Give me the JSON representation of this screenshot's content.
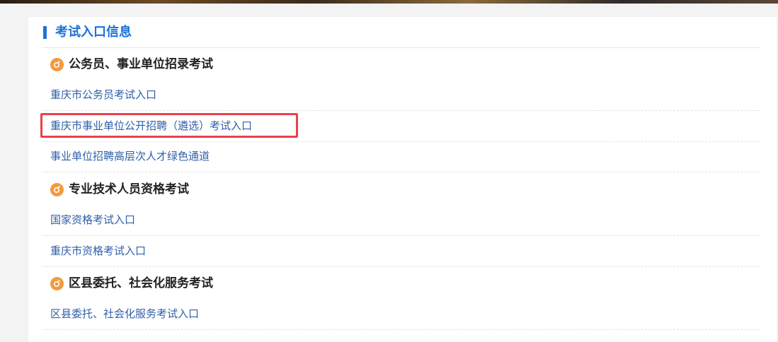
{
  "panel": {
    "title": "考试入口信息"
  },
  "sections": [
    {
      "title": "公务员、事业单位招录考试",
      "links": [
        "重庆市公务员考试入口",
        "重庆市事业单位公开招聘（遴选）考试入口",
        "事业单位招聘高层次人才绿色通道"
      ]
    },
    {
      "title": "专业技术人员资格考试",
      "links": [
        "国家资格考试入口",
        "重庆市资格考试入口"
      ]
    },
    {
      "title": "区县委托、社会化服务考试",
      "links": [
        "区县委托、社会化服务考试入口"
      ]
    }
  ],
  "highlight": {
    "color": "#e8424c"
  },
  "colors": {
    "accent": "#1a73d9",
    "link": "#2f5fa8",
    "section_icon": "#f39a3d"
  }
}
